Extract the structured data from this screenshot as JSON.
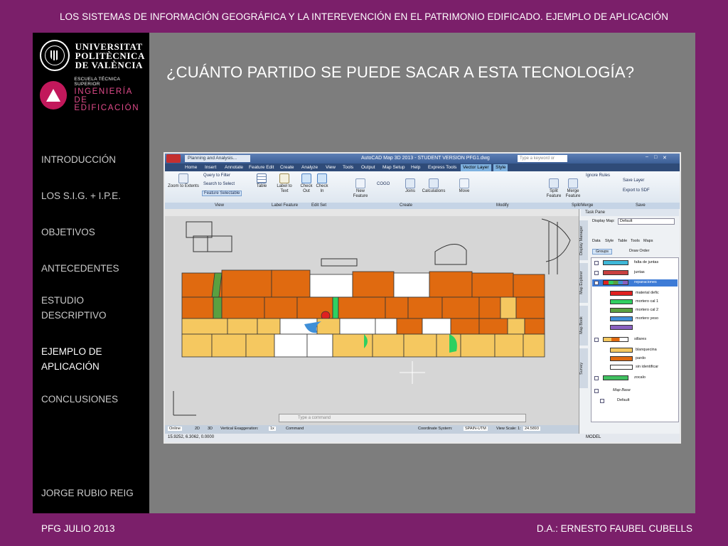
{
  "header": {
    "title": "LOS SISTEMAS DE INFORMACIÓN GEOGRÁFICA Y LA INTEREVENCIÓN EN EL PATRIMONIO EDIFICADO. EJEMPLO DE APLICACIÓN"
  },
  "logos": {
    "upv": {
      "line1": "UNIVERSITAT",
      "line2": "POLITÈCNICA",
      "line3": "DE VALÈNCIA"
    },
    "school": {
      "small": "ESCUELA TÉCNICA SUPERIOR",
      "line1": "INGENIERÍA DE",
      "line2": "EDIFICACIÓN"
    }
  },
  "nav": {
    "items": [
      {
        "label": "INTRODUCCIÓN"
      },
      {
        "label": "LOS S.I.G. + I.P.E."
      },
      {
        "label": "OBJETIVOS"
      },
      {
        "label": "ANTECEDENTES"
      },
      {
        "label": "ESTUDIO DESCRIPTIVO"
      },
      {
        "label": "EJEMPLO DE APLICACIÓN",
        "active": true
      },
      {
        "label": "CONCLUSIONES"
      }
    ],
    "author": "JORGE RUBIO REIG"
  },
  "slide": {
    "title": "¿CUÁNTO PARTIDO SE PUEDE SACAR A ESTA TECNOLOGÍA?"
  },
  "footer": {
    "left": "PFG JULIO 2013",
    "right": "D.A.: ERNESTO FAUBEL CUBELLS"
  },
  "autocad": {
    "workspace": "Planning and Analysis...",
    "window_title": "AutoCAD Map 3D 2013 - STUDENT VERSION    PFG1.dwg",
    "search_placeholder": "Type a keyword or phrase",
    "menu_tabs": [
      "Home",
      "Insert",
      "Annotate",
      "Feature Edit",
      "Create",
      "Analyze",
      "View",
      "Tools",
      "Output",
      "Map Setup",
      "Help",
      "Express Tools",
      "Vector Layer",
      "Style"
    ],
    "active_tab": "Vector Layer",
    "ribbon": {
      "zoom_extents": "Zoom to Extents",
      "query_filter": "Query to Filter",
      "search_select": "Search to Select",
      "feature_selectable": "Feature Selectable",
      "table": "Table",
      "label_to_text": "Label to Text",
      "check_out": "Check Out",
      "check_in": "Check In",
      "new_feature": "New Feature",
      "coord_geom": "COGO",
      "joins": "Joins",
      "calculations": "Calculations",
      "move": "Move",
      "split_feature": "Split Feature",
      "merge_feature": "Merge Feature",
      "ignore_rules": "Ignore Rules",
      "save_layer": "Save Layer",
      "export_sdf": "Export to SDF",
      "groups": [
        "View",
        "Label Feature",
        "Edit Set",
        "Create",
        "Modify",
        "Split/Merge",
        "Save"
      ]
    },
    "task_pane": {
      "title": "Task Pane",
      "display_map_label": "Display Map:",
      "display_map_value": "Default",
      "toolbar": [
        "Data",
        "Style",
        "Table",
        "Tools",
        "Maps"
      ],
      "groups_btn": "Groups",
      "draw_order_btn": "Draw Order",
      "side_tabs": [
        "Display Manager",
        "Map Explorer",
        "Map Book",
        "Survey"
      ],
      "layers": [
        {
          "label": "falta de juntas",
          "color": "#3fb8d8"
        },
        {
          "label": "juntas",
          "color": "#c84040"
        },
        {
          "label": "reparaciones",
          "color": "#2f7fd0",
          "selected": true
        },
        {
          "label": "material defic",
          "color": "#e02020"
        },
        {
          "label": "mortero cal 1",
          "color": "#2fd060"
        },
        {
          "label": "mortero cal 2",
          "color": "#5aa040"
        },
        {
          "label": "mortero yeso",
          "color": "#3f8fd8"
        },
        {
          "label": "sillares",
          "color": "#e0a050"
        },
        {
          "label": "blanquecina",
          "color": "#f0d060"
        },
        {
          "label": "pardo",
          "color": "#e06a10"
        },
        {
          "label": "sin identificar",
          "color": "#ffffff"
        },
        {
          "label": "zocalo",
          "color": "#40c060"
        },
        {
          "label": "Map Base",
          "color": ""
        },
        {
          "label": "Default",
          "color": ""
        }
      ]
    },
    "command_placeholder": "Type a command",
    "status": {
      "online": "Online",
      "view_2d": "2D",
      "view_3d": "3D",
      "vert_exag": "Vertical Exaggeration:",
      "vert_exag_val": "1x",
      "command": "Command",
      "coord_system": "Coordinate System:",
      "coord_value": "SPAIN-UTM",
      "view_scale": "View Scale: 1:",
      "view_scale_val": "24.5893"
    },
    "coords": "15.9252, 6.3062, 0.0000",
    "model": "MODEL",
    "colors": {
      "pardo": "#e06a10",
      "blanquecina": "#f5c860",
      "sin_identificar": "#ffffff",
      "mortero_cal_2": "#5aa040",
      "mortero_cal_1": "#2fd060",
      "mortero_yeso": "#3f8fd8",
      "material_deficiente": "#e02020"
    }
  }
}
